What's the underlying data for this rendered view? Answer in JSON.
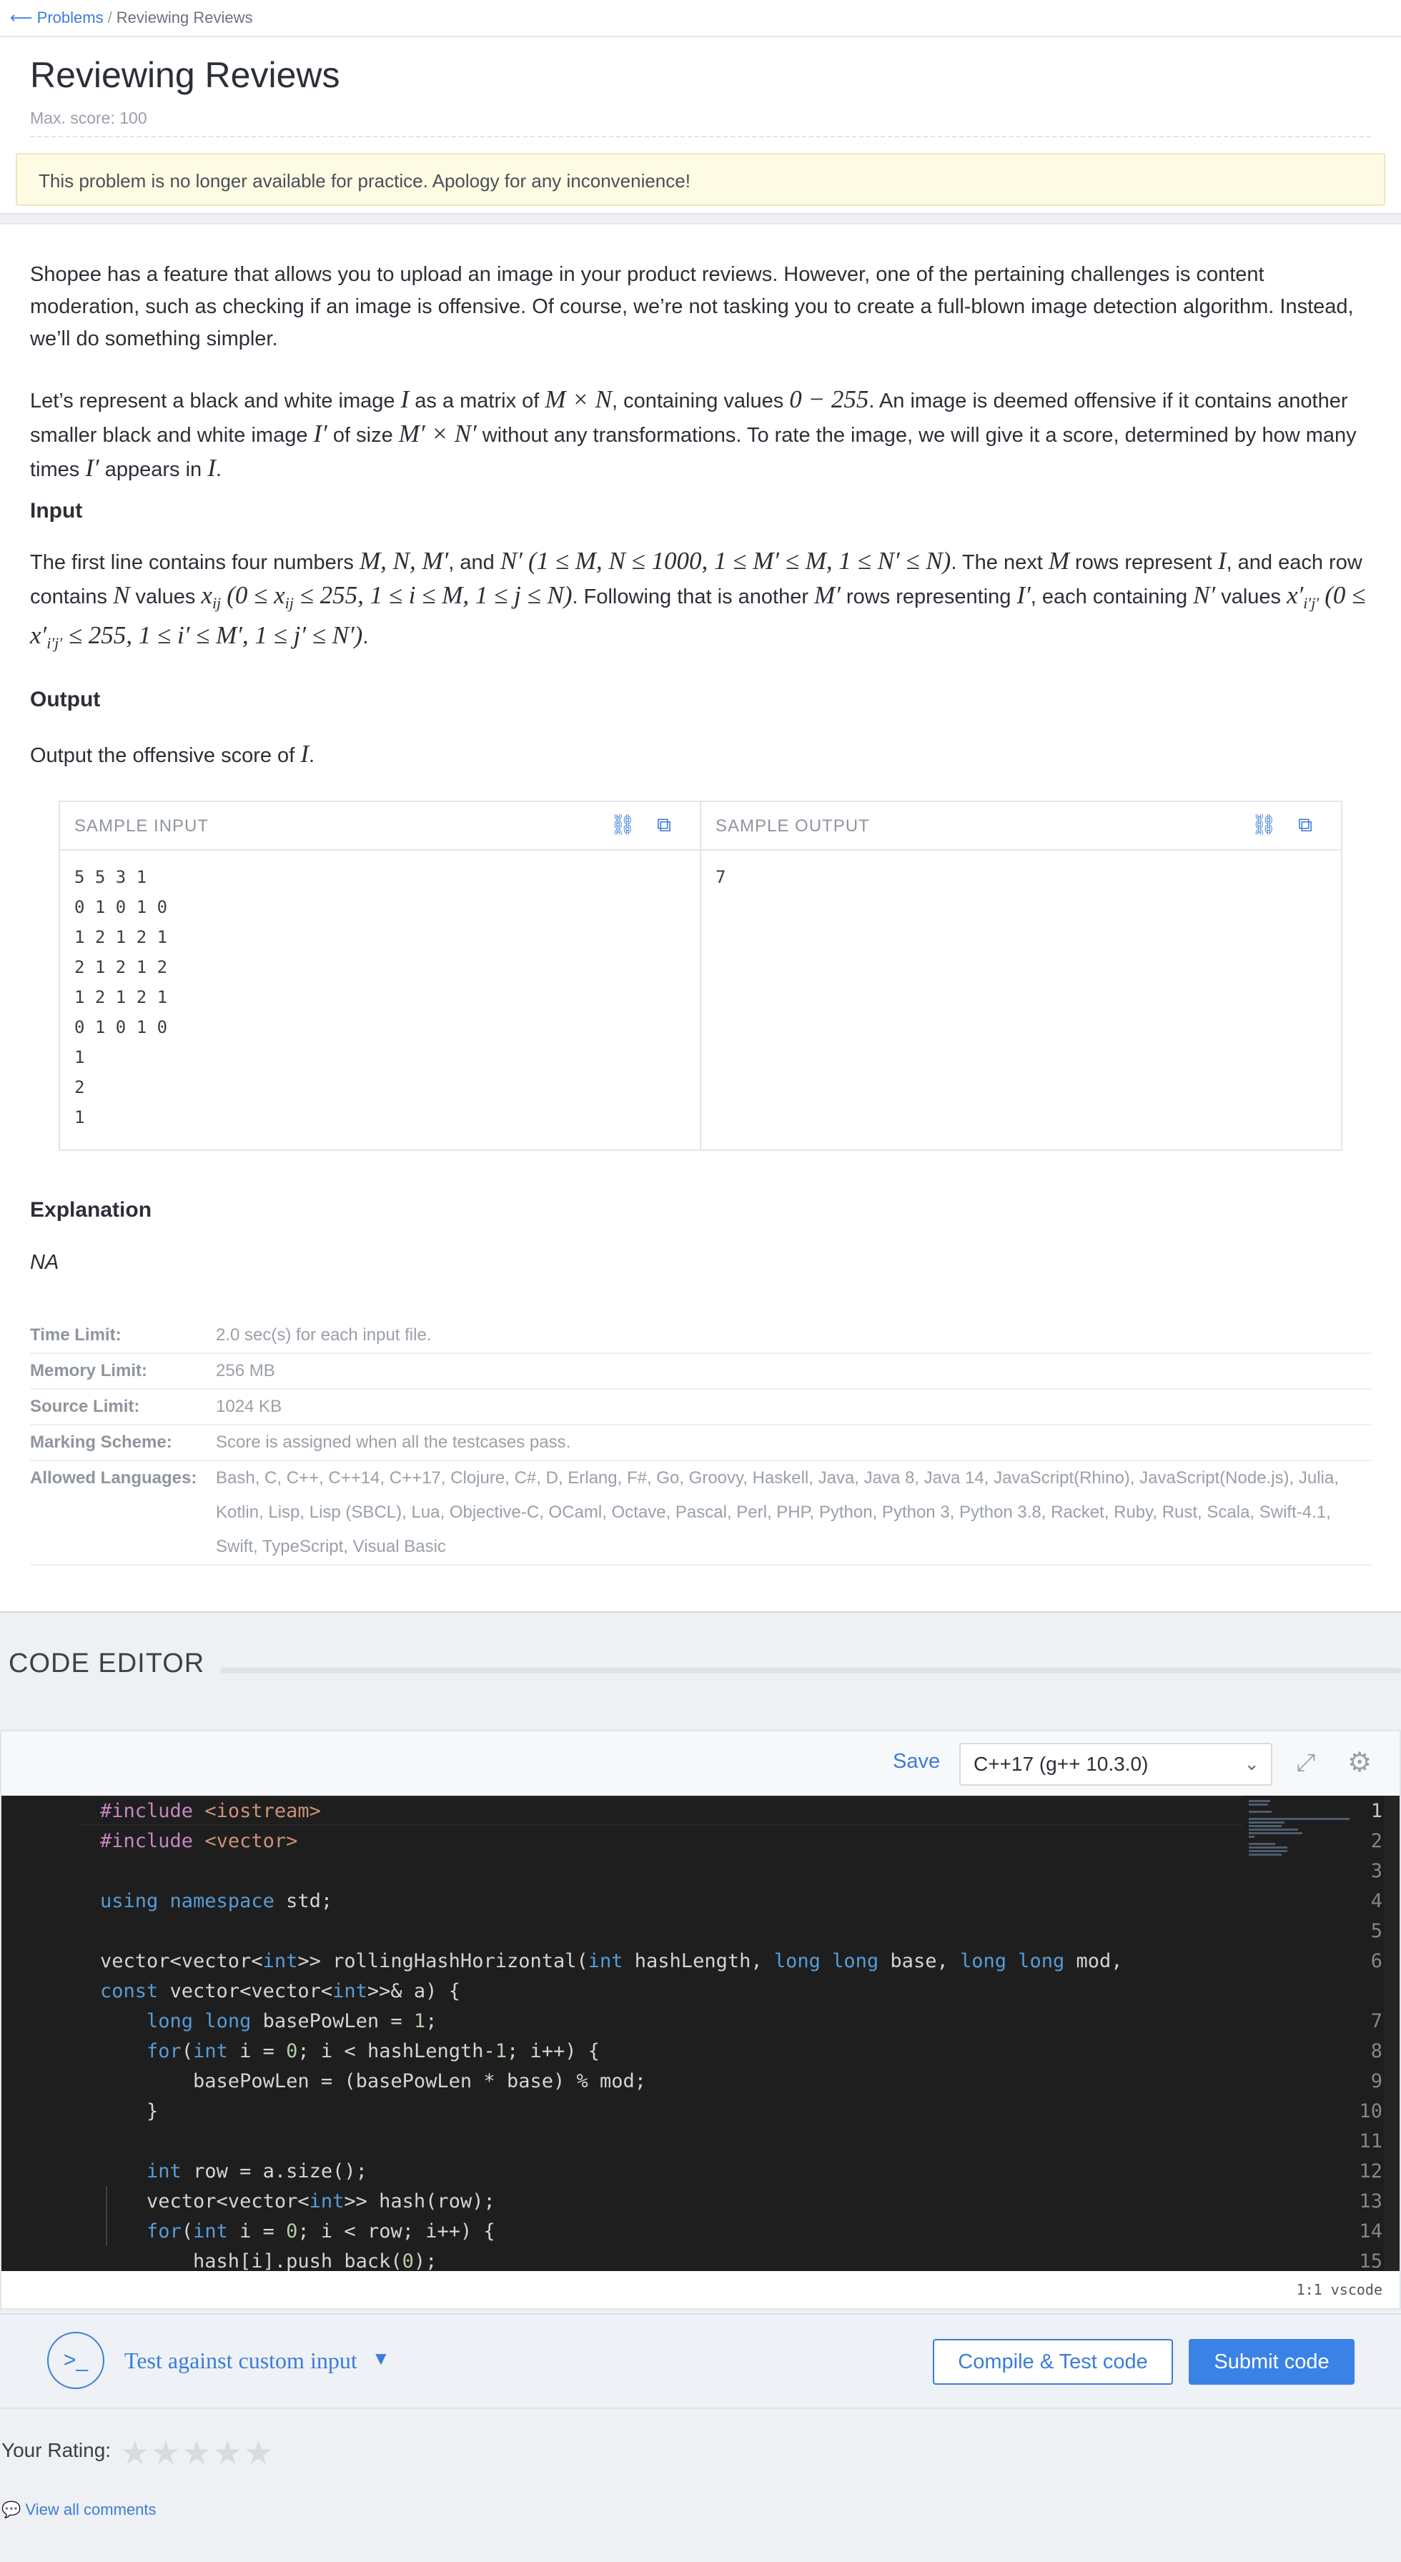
{
  "breadcrumb": {
    "back_arrow": "⟵",
    "link": "Problems",
    "separator": "/",
    "current": "Reviewing Reviews"
  },
  "problem": {
    "title": "Reviewing Reviews",
    "max_score": "Max. score: 100",
    "notice": "This problem is no longer available for practice. Apology for any inconvenience!"
  },
  "statement": {
    "para1": "Shopee has a feature that allows you to upload an image in your product reviews. However, one of the pertaining challenges is content moderation, such as checking if an image is offensive. Of course, we’re not tasking you to create a full-blown image detection algorithm. Instead, we’ll do something simpler.",
    "para2": {
      "t1": "Let’s represent a black and white image ",
      "m1": "I",
      "t2": " as a matrix of ",
      "m2": "M × N",
      "t3": ", containing values ",
      "m3": "0 − 255",
      "t4": ". An image is deemed offensive if it contains another smaller black and white image ",
      "m4": "I′",
      "t5": " of size ",
      "m5": "M′ × N′",
      "t6": " without any transformations. To rate the image, we will give it a score, determined by how many times ",
      "m6": "I′",
      "t7": " appears in ",
      "m7": "I",
      "t8": "."
    },
    "input_heading": "Input",
    "input_text": {
      "t1": "The first line contains four numbers ",
      "m1": "M, N, M′",
      "t2": ", and ",
      "m2": "N′",
      "t3": " ",
      "m3": "(1 ≤ M, N ≤ 1000, 1 ≤ M′ ≤ M, 1 ≤ N′ ≤ N)",
      "t4": ". The next ",
      "m4": "M",
      "t5": " rows represent ",
      "m5": "I",
      "t6": ", and each row contains ",
      "m6": "N",
      "t7": " values ",
      "m7": "x",
      "m7sub": "ij",
      "m8": "(0 ≤ x",
      "m8sub": "ij",
      "m8b": " ≤ 255, 1 ≤ i ≤ M, 1 ≤ j ≤ N)",
      "t8": ". Following that is another ",
      "m9": "M′",
      "t9": " rows representing ",
      "m10": "I′",
      "t10": ", each containing ",
      "m11": "N′",
      "t11": " values ",
      "m12": "x′",
      "m12sub": "i′j′",
      "m13": "(0 ≤ x′",
      "m13sub": "i′j′",
      "m13b": " ≤ 255, 1 ≤ i′ ≤ M′, 1 ≤ j′ ≤ N′)",
      "t12": "."
    },
    "output_heading": "Output",
    "output_text": {
      "t1": "Output the offensive score of ",
      "m1": "I",
      "t2": "."
    },
    "explanation_heading": "Explanation",
    "explanation_text": "NA"
  },
  "samples": {
    "input_title": "SAMPLE INPUT",
    "input_body": "5 5 3 1\n0 1 0 1 0\n1 2 1 2 1\n2 1 2 1 2\n1 2 1 2 1\n0 1 0 1 0\n1\n2\n1",
    "output_title": "SAMPLE OUTPUT",
    "output_body": "7",
    "icons": [
      "link-icon",
      "copy-icon"
    ]
  },
  "limits": [
    {
      "label": "Time Limit:",
      "value": "2.0 sec(s) for each input file."
    },
    {
      "label": "Memory Limit:",
      "value": "256 MB"
    },
    {
      "label": "Source Limit:",
      "value": "1024 KB"
    },
    {
      "label": "Marking Scheme:",
      "value": "Score is assigned when all the testcases pass."
    },
    {
      "label": "Allowed Languages:",
      "value": "Bash, C, C++, C++14, C++17, Clojure, C#, D, Erlang, F#, Go, Groovy, Haskell, Java, Java 8, Java 14, JavaScript(Rhino), JavaScript(Node.js), Julia, Kotlin, Lisp, Lisp (SBCL), Lua, Objective-C, OCaml, Octave, Pascal, Perl, PHP, Python, Python 3, Python 3.8, Racket, Ruby, Rust, Scala, Swift-4.1, Swift, TypeScript, Visual Basic"
    }
  ],
  "editor": {
    "heading": "CODE EDITOR",
    "save_label": "Save",
    "language": "C++17 (g++ 10.3.0)",
    "status": "1:1 vscode",
    "lines": [
      {
        "n": "1",
        "tokens": [
          {
            "c": "pp",
            "t": "#include "
          },
          {
            "c": "str",
            "t": "<iostream>"
          }
        ]
      },
      {
        "n": "2",
        "tokens": [
          {
            "c": "pp",
            "t": "#include "
          },
          {
            "c": "str",
            "t": "<vector>"
          }
        ]
      },
      {
        "n": "3",
        "tokens": []
      },
      {
        "n": "4",
        "tokens": [
          {
            "c": "kw",
            "t": "using namespace"
          },
          {
            "c": "",
            "t": " std;"
          }
        ]
      },
      {
        "n": "5",
        "tokens": []
      },
      {
        "n": "6",
        "tokens": [
          {
            "c": "",
            "t": "vector<vector<"
          },
          {
            "c": "kw",
            "t": "int"
          },
          {
            "c": "",
            "t": ">> rollingHashHorizontal("
          },
          {
            "c": "kw",
            "t": "int"
          },
          {
            "c": "",
            "t": " hashLength, "
          },
          {
            "c": "kw",
            "t": "long long"
          },
          {
            "c": "",
            "t": " base, "
          },
          {
            "c": "kw",
            "t": "long long"
          },
          {
            "c": "",
            "t": " mod,"
          }
        ]
      },
      {
        "n": "",
        "tokens": [
          {
            "c": "kw",
            "t": "const"
          },
          {
            "c": "",
            "t": " vector<vector<"
          },
          {
            "c": "kw",
            "t": "int"
          },
          {
            "c": "",
            "t": ">>& a) {"
          }
        ]
      },
      {
        "n": "7",
        "tokens": [
          {
            "c": "",
            "t": "    "
          },
          {
            "c": "kw",
            "t": "long long"
          },
          {
            "c": "",
            "t": " basePowLen = "
          },
          {
            "c": "num",
            "t": "1"
          },
          {
            "c": "",
            "t": ";"
          }
        ]
      },
      {
        "n": "8",
        "tokens": [
          {
            "c": "",
            "t": "    "
          },
          {
            "c": "kw",
            "t": "for"
          },
          {
            "c": "",
            "t": "("
          },
          {
            "c": "kw",
            "t": "int"
          },
          {
            "c": "",
            "t": " i = "
          },
          {
            "c": "num",
            "t": "0"
          },
          {
            "c": "",
            "t": "; i < hashLength-"
          },
          {
            "c": "num",
            "t": "1"
          },
          {
            "c": "",
            "t": "; i++) {"
          }
        ]
      },
      {
        "n": "9",
        "tokens": [
          {
            "c": "",
            "t": "        basePowLen = (basePowLen * base) % mod;"
          }
        ]
      },
      {
        "n": "10",
        "tokens": [
          {
            "c": "",
            "t": "    }"
          }
        ]
      },
      {
        "n": "11",
        "tokens": []
      },
      {
        "n": "12",
        "tokens": [
          {
            "c": "",
            "t": "    "
          },
          {
            "c": "kw",
            "t": "int"
          },
          {
            "c": "",
            "t": " row = a.size();"
          }
        ]
      },
      {
        "n": "13",
        "tokens": [
          {
            "c": "",
            "t": "    vector<vector<"
          },
          {
            "c": "kw",
            "t": "int"
          },
          {
            "c": "",
            "t": ">> hash(row);"
          }
        ]
      },
      {
        "n": "14",
        "tokens": [
          {
            "c": "",
            "t": "    "
          },
          {
            "c": "kw",
            "t": "for"
          },
          {
            "c": "",
            "t": "("
          },
          {
            "c": "kw",
            "t": "int"
          },
          {
            "c": "",
            "t": " i = "
          },
          {
            "c": "num",
            "t": "0"
          },
          {
            "c": "",
            "t": "; i < row; i++) {"
          }
        ]
      },
      {
        "n": "15",
        "tokens": [
          {
            "c": "",
            "t": "        hash[i].push_back("
          },
          {
            "c": "num",
            "t": "0"
          },
          {
            "c": "",
            "t": ");"
          }
        ]
      }
    ],
    "colors": {
      "keyword": "#569cd6",
      "number": "#b5cea8",
      "string": "#ce9178",
      "preprocessor": "#c586c0",
      "background": "#1e1e1e"
    }
  },
  "actions": {
    "test_label": "Test against custom input",
    "compile_label": "Compile & Test code",
    "submit_label": "Submit code"
  },
  "rating": {
    "label": "Your Rating:",
    "stars": "★★★★★"
  },
  "comments_link": "View all comments",
  "colors": {
    "accent": "#3b7dd8",
    "notice_bg": "#fdfbe4"
  }
}
